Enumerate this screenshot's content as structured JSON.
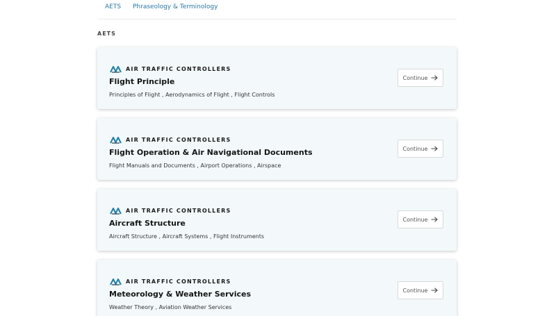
{
  "tabs": [
    {
      "label": "AETS"
    },
    {
      "label": "Phraseology & Terminology"
    }
  ],
  "section": {
    "label": "AETS"
  },
  "brand": {
    "text": "AIR TRAFFIC CONTROLLERS",
    "accent_color": "#1f7fa3"
  },
  "continue_label": "Continue",
  "cards": [
    {
      "title": "Flight Principle",
      "subtitle": "Principles of Flight , Aerodynamics of Flight , Flight Controls"
    },
    {
      "title": "Flight Operation & Air Navigational Documents",
      "subtitle": "Flight Manuals and Documents , Airport Operations , Airspace"
    },
    {
      "title": "Aircraft Structure",
      "subtitle": "Aircraft Structure , Aircraft Systems , Flight Instruments"
    },
    {
      "title": "Meteorology & Weather Services",
      "subtitle": "Weather Theory , Aviation Weather Services"
    }
  ]
}
